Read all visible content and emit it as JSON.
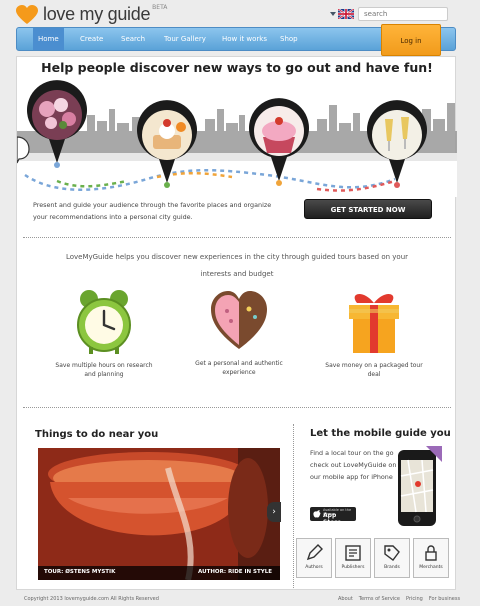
{
  "brand": {
    "name": "love my guide",
    "beta": "BETA",
    "accent": "#f59a1b"
  },
  "search": {
    "placeholder": "search"
  },
  "nav": {
    "items": [
      "Home",
      "Create",
      "Search",
      "Tour Gallery",
      "How it works",
      "Shop"
    ],
    "login": "Log in"
  },
  "hero": {
    "title": "Help people discover new ways to go out and have fun!",
    "pins": [
      "flowers-pin",
      "dessert-pin",
      "cupcake-pin",
      "champagne-pin"
    ]
  },
  "intro": {
    "text": "Present and guide your audience through the favorite places and organize your recommendations into a personal city guide.",
    "cta": "GET STARTED NOW"
  },
  "tagline": "LoveMyGuide helps you discover new experiences in the city through guided tours based on your interests and budget",
  "features": [
    {
      "icon": "alarm-clock-icon",
      "label": "Save multiple hours on research and planning"
    },
    {
      "icon": "heart-icon",
      "label": "Get a personal and authentic experience"
    },
    {
      "icon": "gift-icon",
      "label": "Save money on a packaged tour deal"
    }
  ],
  "near": {
    "heading": "Things to do near you",
    "caption_left": "TOUR: ØSTENS MYSTIK",
    "caption_right": "AUTHOR: RIDE IN STYLE"
  },
  "mobile": {
    "heading": "Let the mobile guide you",
    "text": "Find a local tour on the go check out LoveMyGuide on our mobile app for iPhone",
    "appstore_small": "Available on the iPhone",
    "appstore_big": "App Store"
  },
  "roles": [
    "Authors",
    "Publishers",
    "Brands",
    "Merchants"
  ],
  "footer": {
    "copyright": "Copyright 2013 lovemyguide.com      All Rights Reserved",
    "links": [
      "About",
      "Terms of Service",
      "Pricing",
      "For business"
    ]
  }
}
